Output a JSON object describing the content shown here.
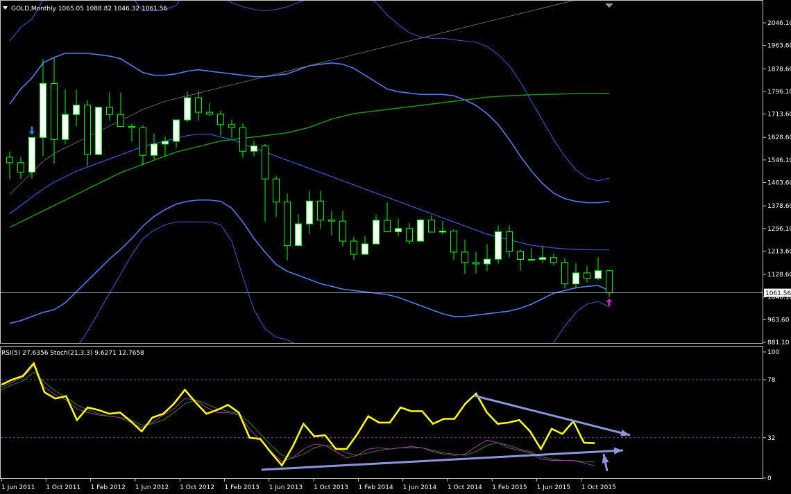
{
  "window": {
    "symbol_line": "GOLD,Monthly  1065.05 1088.82 1046.32 1061.56",
    "current_price_label": "1061.56"
  },
  "colors": {
    "background": "#000000",
    "frame": "#c8c8c8",
    "text": "#ffffff",
    "bull_candle": "#ffffff",
    "bear_candle": "#000000",
    "wick": "#00ff00",
    "bollinger_outer": "#3c5ad2",
    "bollinger_middle": "#5a78f0",
    "ma_long": "#1e8c1e",
    "ma_grey": "#787878",
    "rsi": "#ffff00",
    "stoch_main": "#b43cb4",
    "stoch_signal": "#1e9628",
    "trendline": "#8c96dc",
    "level_line": "#8050a0",
    "signal_arrow_down": "#2d7bd4",
    "signal_arrow_up": "#c828c8"
  },
  "price_axis": {
    "ticks": [
      "2046.10",
      "1963.60",
      "1878.60",
      "1796.10",
      "1713.60",
      "1628.60",
      "1546.10",
      "1463.60",
      "1378.60",
      "1296.10",
      "1213.60",
      "1128.60",
      "1046.10",
      "963.60",
      "881.10"
    ]
  },
  "oscillator": {
    "header": "RSI(5) 27.6356  Stoch(21,3,3) 9.6271 12.7658",
    "levels": [
      "100",
      "78",
      "32",
      "0"
    ]
  },
  "time_axis": {
    "labels": [
      "1 Jun 2011",
      "1 Oct 2011",
      "1 Feb 2012",
      "1 Jun 2012",
      "1 Oct 2012",
      "1 Feb 2013",
      "1 Jun 2013",
      "1 Oct 2013",
      "1 Feb 2014",
      "1 Jun 2014",
      "1 Oct 2014",
      "1 Feb 2015",
      "1 Jun 2015",
      "1 Oct 2015"
    ]
  },
  "chart_data": [
    {
      "type": "candlestick",
      "symbol": "GOLD",
      "timeframe": "Monthly",
      "last_bar": {
        "open": 1065.05,
        "high": 1088.82,
        "low": 1046.32,
        "close": 1061.56
      },
      "ylim": [
        881.1,
        2046.1
      ],
      "x": [
        "2011-05",
        "2011-06",
        "2011-07",
        "2011-08",
        "2011-09",
        "2011-10",
        "2011-11",
        "2011-12",
        "2012-01",
        "2012-02",
        "2012-03",
        "2012-04",
        "2012-05",
        "2012-06",
        "2012-07",
        "2012-08",
        "2012-09",
        "2012-10",
        "2012-11",
        "2012-12",
        "2013-01",
        "2013-02",
        "2013-03",
        "2013-04",
        "2013-05",
        "2013-06",
        "2013-07",
        "2013-08",
        "2013-09",
        "2013-10",
        "2013-11",
        "2013-12",
        "2014-01",
        "2014-02",
        "2014-03",
        "2014-04",
        "2014-05",
        "2014-06",
        "2014-07",
        "2014-08",
        "2014-09",
        "2014-10",
        "2014-11",
        "2014-12",
        "2015-01",
        "2015-02",
        "2015-03",
        "2015-04",
        "2015-05",
        "2015-06",
        "2015-07",
        "2015-08",
        "2015-09",
        "2015-10",
        "2015-11"
      ],
      "open": [
        1556,
        1536,
        1502,
        1628,
        1825,
        1621,
        1712,
        1746,
        1566,
        1738,
        1712,
        1668,
        1664,
        1563,
        1604,
        1614,
        1692,
        1773,
        1720,
        1713,
        1675,
        1664,
        1578,
        1597,
        1477,
        1393,
        1234,
        1313,
        1396,
        1327,
        1323,
        1250,
        1202,
        1240,
        1326,
        1284,
        1296,
        1250,
        1327,
        1283,
        1287,
        1210,
        1172,
        1167,
        1184,
        1284,
        1213,
        1183,
        1183,
        1190,
        1172,
        1094,
        1134,
        1114,
        1142
      ],
      "high": [
        1577,
        1557,
        1628,
        1913,
        1921,
        1803,
        1803,
        1764,
        1739,
        1792,
        1791,
        1678,
        1674,
        1642,
        1631,
        1694,
        1795,
        1798,
        1754,
        1726,
        1694,
        1679,
        1616,
        1604,
        1488,
        1424,
        1348,
        1434,
        1434,
        1362,
        1361,
        1265,
        1268,
        1345,
        1392,
        1332,
        1316,
        1331,
        1345,
        1324,
        1292,
        1255,
        1211,
        1238,
        1307,
        1308,
        1219,
        1224,
        1232,
        1205,
        1188,
        1170,
        1160,
        1192,
        1146
      ],
      "low": [
        1477,
        1477,
        1478,
        1561,
        1532,
        1603,
        1669,
        1523,
        1563,
        1689,
        1684,
        1613,
        1527,
        1548,
        1561,
        1590,
        1684,
        1689,
        1706,
        1635,
        1626,
        1554,
        1560,
        1321,
        1338,
        1179,
        1231,
        1276,
        1296,
        1270,
        1230,
        1181,
        1200,
        1240,
        1285,
        1268,
        1240,
        1246,
        1287,
        1275,
        1180,
        1130,
        1132,
        1141,
        1167,
        1191,
        1142,
        1177,
        1170,
        1162,
        1077,
        1077,
        1099,
        1108,
        1046
      ],
      "close": [
        1536,
        1502,
        1628,
        1825,
        1621,
        1712,
        1746,
        1566,
        1738,
        1712,
        1668,
        1664,
        1563,
        1604,
        1614,
        1692,
        1773,
        1720,
        1713,
        1675,
        1664,
        1578,
        1597,
        1477,
        1393,
        1234,
        1313,
        1396,
        1327,
        1323,
        1250,
        1202,
        1240,
        1326,
        1284,
        1296,
        1250,
        1327,
        1283,
        1287,
        1210,
        1172,
        1167,
        1184,
        1284,
        1213,
        1183,
        1183,
        1190,
        1172,
        1094,
        1134,
        1114,
        1142,
        1061.56
      ],
      "series": [
        {
          "name": "Bollinger upper (outer)",
          "values": [
            1980,
            2030,
            2060,
            2130,
            2190,
            2220,
            2230,
            2240,
            2235,
            2220,
            2200,
            2140,
            2090,
            2090,
            2095,
            2110,
            2170,
            2175,
            2160,
            2140,
            2120,
            2105,
            2095,
            2090,
            2095,
            2105,
            2120,
            2135,
            2145,
            2150,
            2155,
            2155,
            2150,
            2120,
            2075,
            2040,
            2010,
            1995,
            1990,
            1990,
            1985,
            1980,
            1975,
            1960,
            1930,
            1890,
            1830,
            1760,
            1690,
            1620,
            1560,
            1510,
            1480,
            1470,
            1480
          ]
        },
        {
          "name": "Bollinger upper",
          "values": [
            1750,
            1805,
            1845,
            1900,
            1920,
            1935,
            1935,
            1935,
            1930,
            1925,
            1915,
            1890,
            1865,
            1855,
            1855,
            1860,
            1870,
            1875,
            1870,
            1865,
            1860,
            1855,
            1850,
            1850,
            1855,
            1860,
            1875,
            1890,
            1895,
            1900,
            1895,
            1880,
            1855,
            1830,
            1805,
            1795,
            1790,
            1785,
            1785,
            1785,
            1780,
            1765,
            1745,
            1715,
            1675,
            1620,
            1560,
            1505,
            1460,
            1425,
            1405,
            1395,
            1390,
            1390,
            1395
          ]
        },
        {
          "name": "Bollinger middle",
          "values": [
            1350,
            1380,
            1410,
            1440,
            1465,
            1485,
            1505,
            1520,
            1535,
            1550,
            1565,
            1580,
            1595,
            1605,
            1615,
            1625,
            1635,
            1640,
            1640,
            1630,
            1620,
            1605,
            1590,
            1575,
            1560,
            1545,
            1530,
            1515,
            1500,
            1485,
            1470,
            1455,
            1440,
            1425,
            1410,
            1395,
            1380,
            1365,
            1350,
            1335,
            1320,
            1305,
            1290,
            1275,
            1265,
            1255,
            1245,
            1235,
            1230,
            1225,
            1222,
            1220,
            1219,
            1218,
            1218
          ]
        },
        {
          "name": "Bollinger lower",
          "values": [
            950,
            960,
            975,
            990,
            1000,
            1025,
            1065,
            1105,
            1145,
            1185,
            1220,
            1260,
            1305,
            1340,
            1365,
            1385,
            1395,
            1400,
            1400,
            1395,
            1370,
            1320,
            1260,
            1210,
            1165,
            1140,
            1125,
            1110,
            1095,
            1085,
            1075,
            1070,
            1065,
            1060,
            1055,
            1045,
            1030,
            1015,
            1000,
            985,
            975,
            975,
            980,
            985,
            990,
            995,
            1005,
            1020,
            1040,
            1060,
            1070,
            1080,
            1085,
            1088,
            1070
          ]
        },
        {
          "name": "Bollinger lower (outer)",
          "values": [
            720,
            730,
            745,
            760,
            780,
            810,
            860,
            920,
            990,
            1060,
            1130,
            1200,
            1260,
            1290,
            1310,
            1320,
            1320,
            1320,
            1320,
            1310,
            1250,
            1120,
            1000,
            930,
            900,
            890,
            870,
            855,
            840,
            830,
            820,
            815,
            810,
            808,
            805,
            800,
            795,
            790,
            785,
            780,
            775,
            770,
            765,
            760,
            760,
            760,
            770,
            785,
            820,
            880,
            940,
            990,
            1020,
            1030,
            1010
          ]
        },
        {
          "name": "Long moving average",
          "values": [
            1300,
            1320,
            1340,
            1360,
            1380,
            1400,
            1420,
            1440,
            1460,
            1480,
            1500,
            1515,
            1530,
            1545,
            1560,
            1575,
            1585,
            1595,
            1605,
            1615,
            1620,
            1625,
            1630,
            1635,
            1640,
            1645,
            1655,
            1665,
            1680,
            1695,
            1705,
            1715,
            1720,
            1725,
            1730,
            1735,
            1740,
            1745,
            1750,
            1755,
            1760,
            1765,
            1770,
            1775,
            1778,
            1780,
            1782,
            1784,
            1785,
            1786,
            1787,
            1788,
            1788,
            1788,
            1789
          ]
        },
        {
          "name": "Grey moving average",
          "values": [
            1420,
            1460,
            1500,
            1540,
            1570,
            1590,
            1610,
            1630,
            1650,
            1670,
            1690,
            1710,
            1730,
            1745,
            1760,
            1770,
            1780,
            1790,
            1800,
            1810,
            1820,
            1830,
            1840,
            1850,
            1860,
            1870,
            1880,
            1890,
            1900,
            1910,
            1920,
            1930,
            1940,
            1950,
            1960,
            1970,
            1980,
            1990,
            2000,
            2010,
            2020,
            2030,
            2040,
            2050,
            2060,
            2070,
            2080,
            2090,
            2100,
            2110,
            2120,
            2130,
            2140,
            2150,
            2160
          ]
        }
      ]
    },
    {
      "type": "line",
      "ylim": [
        0,
        100
      ],
      "levels": [
        78,
        32
      ],
      "series": [
        {
          "name": "RSI(5)",
          "values": [
            74,
            78,
            81,
            91,
            68,
            63,
            65,
            46,
            56,
            54,
            51,
            52,
            45,
            37,
            48,
            51,
            59,
            70,
            60,
            51,
            54,
            58,
            52,
            32,
            31,
            20,
            10,
            25,
            43,
            33,
            34,
            23,
            23,
            35,
            49,
            44,
            44,
            56,
            53,
            53,
            43,
            47,
            47,
            59,
            67,
            52,
            43,
            44,
            46,
            37,
            23,
            39,
            35,
            45,
            28,
            27.6356
          ]
        },
        {
          "name": "Stoch(21,3,3) main",
          "values": [
            72,
            76,
            80,
            89,
            72,
            66,
            62,
            55,
            52,
            50,
            49,
            48,
            44,
            40,
            44,
            50,
            55,
            63,
            62,
            56,
            52,
            52,
            50,
            39,
            30,
            21,
            13,
            16,
            23,
            27,
            26,
            21,
            16,
            18,
            23,
            24,
            23,
            24,
            25,
            24,
            21,
            19,
            18,
            19,
            25,
            30,
            28,
            24,
            22,
            20,
            15,
            14,
            14,
            14,
            12,
            9.6271
          ]
        },
        {
          "name": "Stoch(21,3,3) signal",
          "values": [
            70,
            74,
            77,
            84,
            76,
            69,
            64,
            58,
            54,
            51,
            49,
            48,
            46,
            42,
            43,
            46,
            52,
            59,
            62,
            59,
            55,
            53,
            51,
            44,
            35,
            26,
            18,
            16,
            19,
            24,
            26,
            24,
            20,
            18,
            20,
            22,
            23,
            24,
            24,
            24,
            22,
            20,
            19,
            18,
            21,
            26,
            28,
            26,
            23,
            21,
            17,
            15,
            14,
            14,
            13,
            12.7658
          ]
        }
      ]
    }
  ]
}
